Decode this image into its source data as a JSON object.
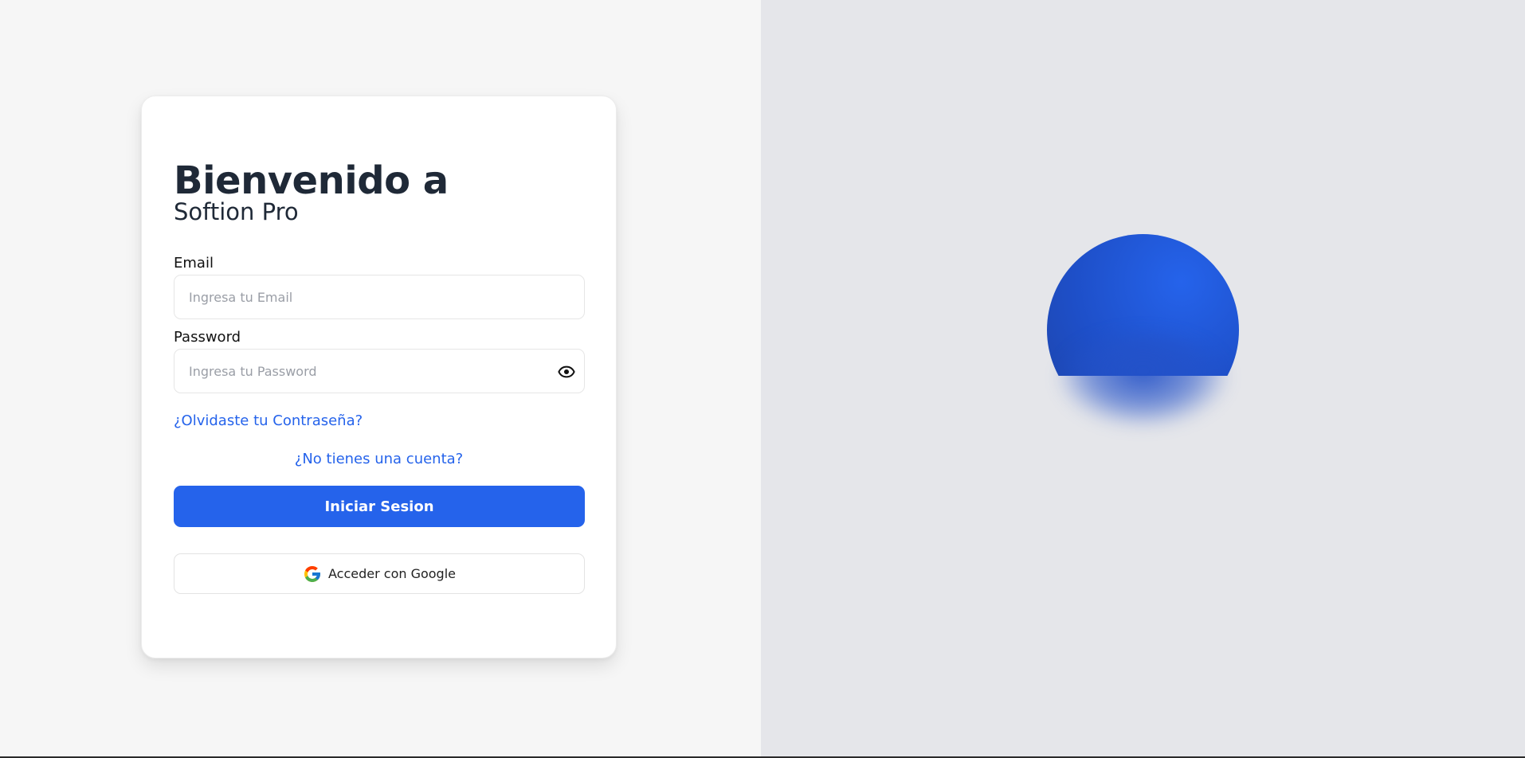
{
  "login": {
    "title": "Bienvenido a",
    "subtitle": "Softion Pro",
    "email_label": "Email",
    "email_placeholder": "Ingresa tu Email",
    "password_label": "Password",
    "password_placeholder": "Ingresa tu Password",
    "forgot_link": "¿Olvidaste tu Contraseña?",
    "signup_link": "¿No tienes una cuenta?",
    "submit_label": "Iniciar Sesion",
    "google_label": "Acceder con Google",
    "icons": {
      "password_toggle": "eye-icon",
      "google": "google-logo-icon"
    }
  },
  "theme": {
    "accent": "#2563eb",
    "text": "#1f2937",
    "left_bg": "#f6f6f6",
    "right_bg": "#e5e6ea"
  }
}
